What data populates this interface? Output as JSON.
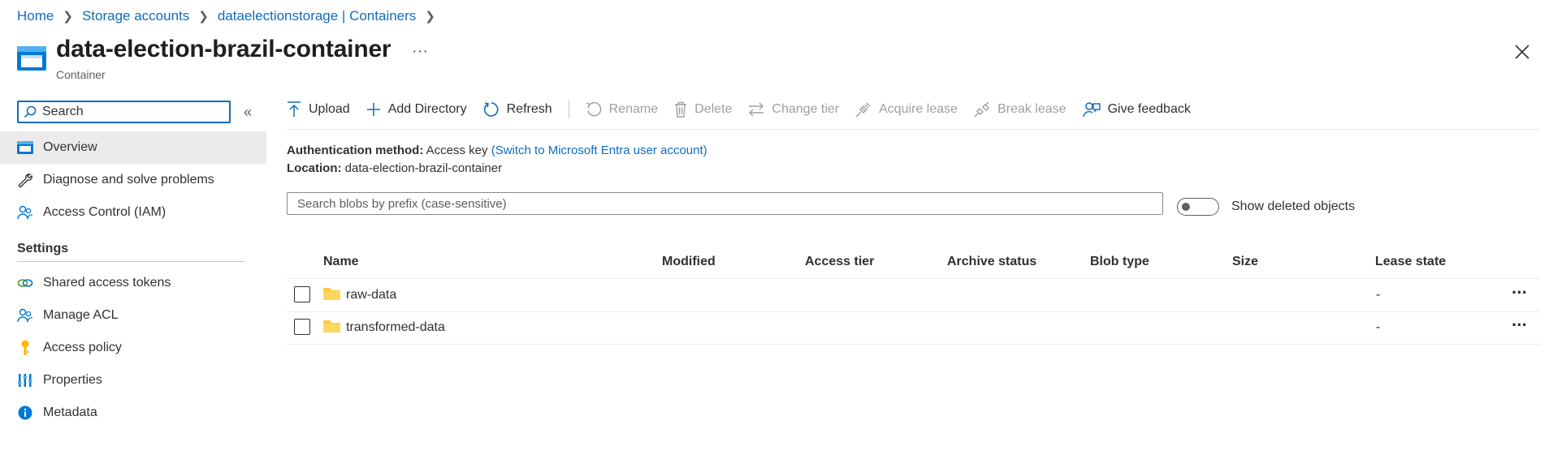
{
  "breadcrumb": [
    {
      "label": "Home"
    },
    {
      "label": "Storage accounts"
    },
    {
      "label": "dataelectionstorage | Containers"
    }
  ],
  "header": {
    "title": "data-election-brazil-container",
    "subtitle": "Container",
    "more_label": "···"
  },
  "sidebar": {
    "search_placeholder": "Search",
    "collapse_label": "«",
    "items": [
      {
        "label": "Overview",
        "icon": "overview-icon",
        "active": true
      },
      {
        "label": "Diagnose and solve problems",
        "icon": "wrench-icon"
      },
      {
        "label": "Access Control (IAM)",
        "icon": "people-icon"
      }
    ],
    "settings_heading": "Settings",
    "settings_items": [
      {
        "label": "Shared access tokens",
        "icon": "link-icon"
      },
      {
        "label": "Manage ACL",
        "icon": "people-icon"
      },
      {
        "label": "Access policy",
        "icon": "key-icon"
      },
      {
        "label": "Properties",
        "icon": "sliders-icon"
      },
      {
        "label": "Metadata",
        "icon": "info-icon"
      }
    ]
  },
  "toolbar": {
    "upload": "Upload",
    "add_directory": "Add Directory",
    "refresh": "Refresh",
    "rename": "Rename",
    "delete": "Delete",
    "change_tier": "Change tier",
    "acquire_lease": "Acquire lease",
    "break_lease": "Break lease",
    "give_feedback": "Give feedback"
  },
  "info": {
    "auth_label": "Authentication method:",
    "auth_value": "Access key",
    "auth_link": "(Switch to Microsoft Entra user account)",
    "location_label": "Location:",
    "location_value": "data-election-brazil-container"
  },
  "filter": {
    "prefix_placeholder": "Search blobs by prefix (case-sensitive)",
    "show_deleted_label": "Show deleted objects",
    "show_deleted": false
  },
  "table": {
    "columns": [
      "Name",
      "Modified",
      "Access tier",
      "Archive status",
      "Blob type",
      "Size",
      "Lease state"
    ],
    "rows": [
      {
        "name": "raw-data",
        "lease_state": "-",
        "more": "···"
      },
      {
        "name": "transformed-data",
        "lease_state": "-",
        "more": "···"
      }
    ]
  },
  "colors": {
    "accent": "#0f6cbd",
    "folder": "#ffc83d",
    "active_bg": "#edebe9"
  }
}
